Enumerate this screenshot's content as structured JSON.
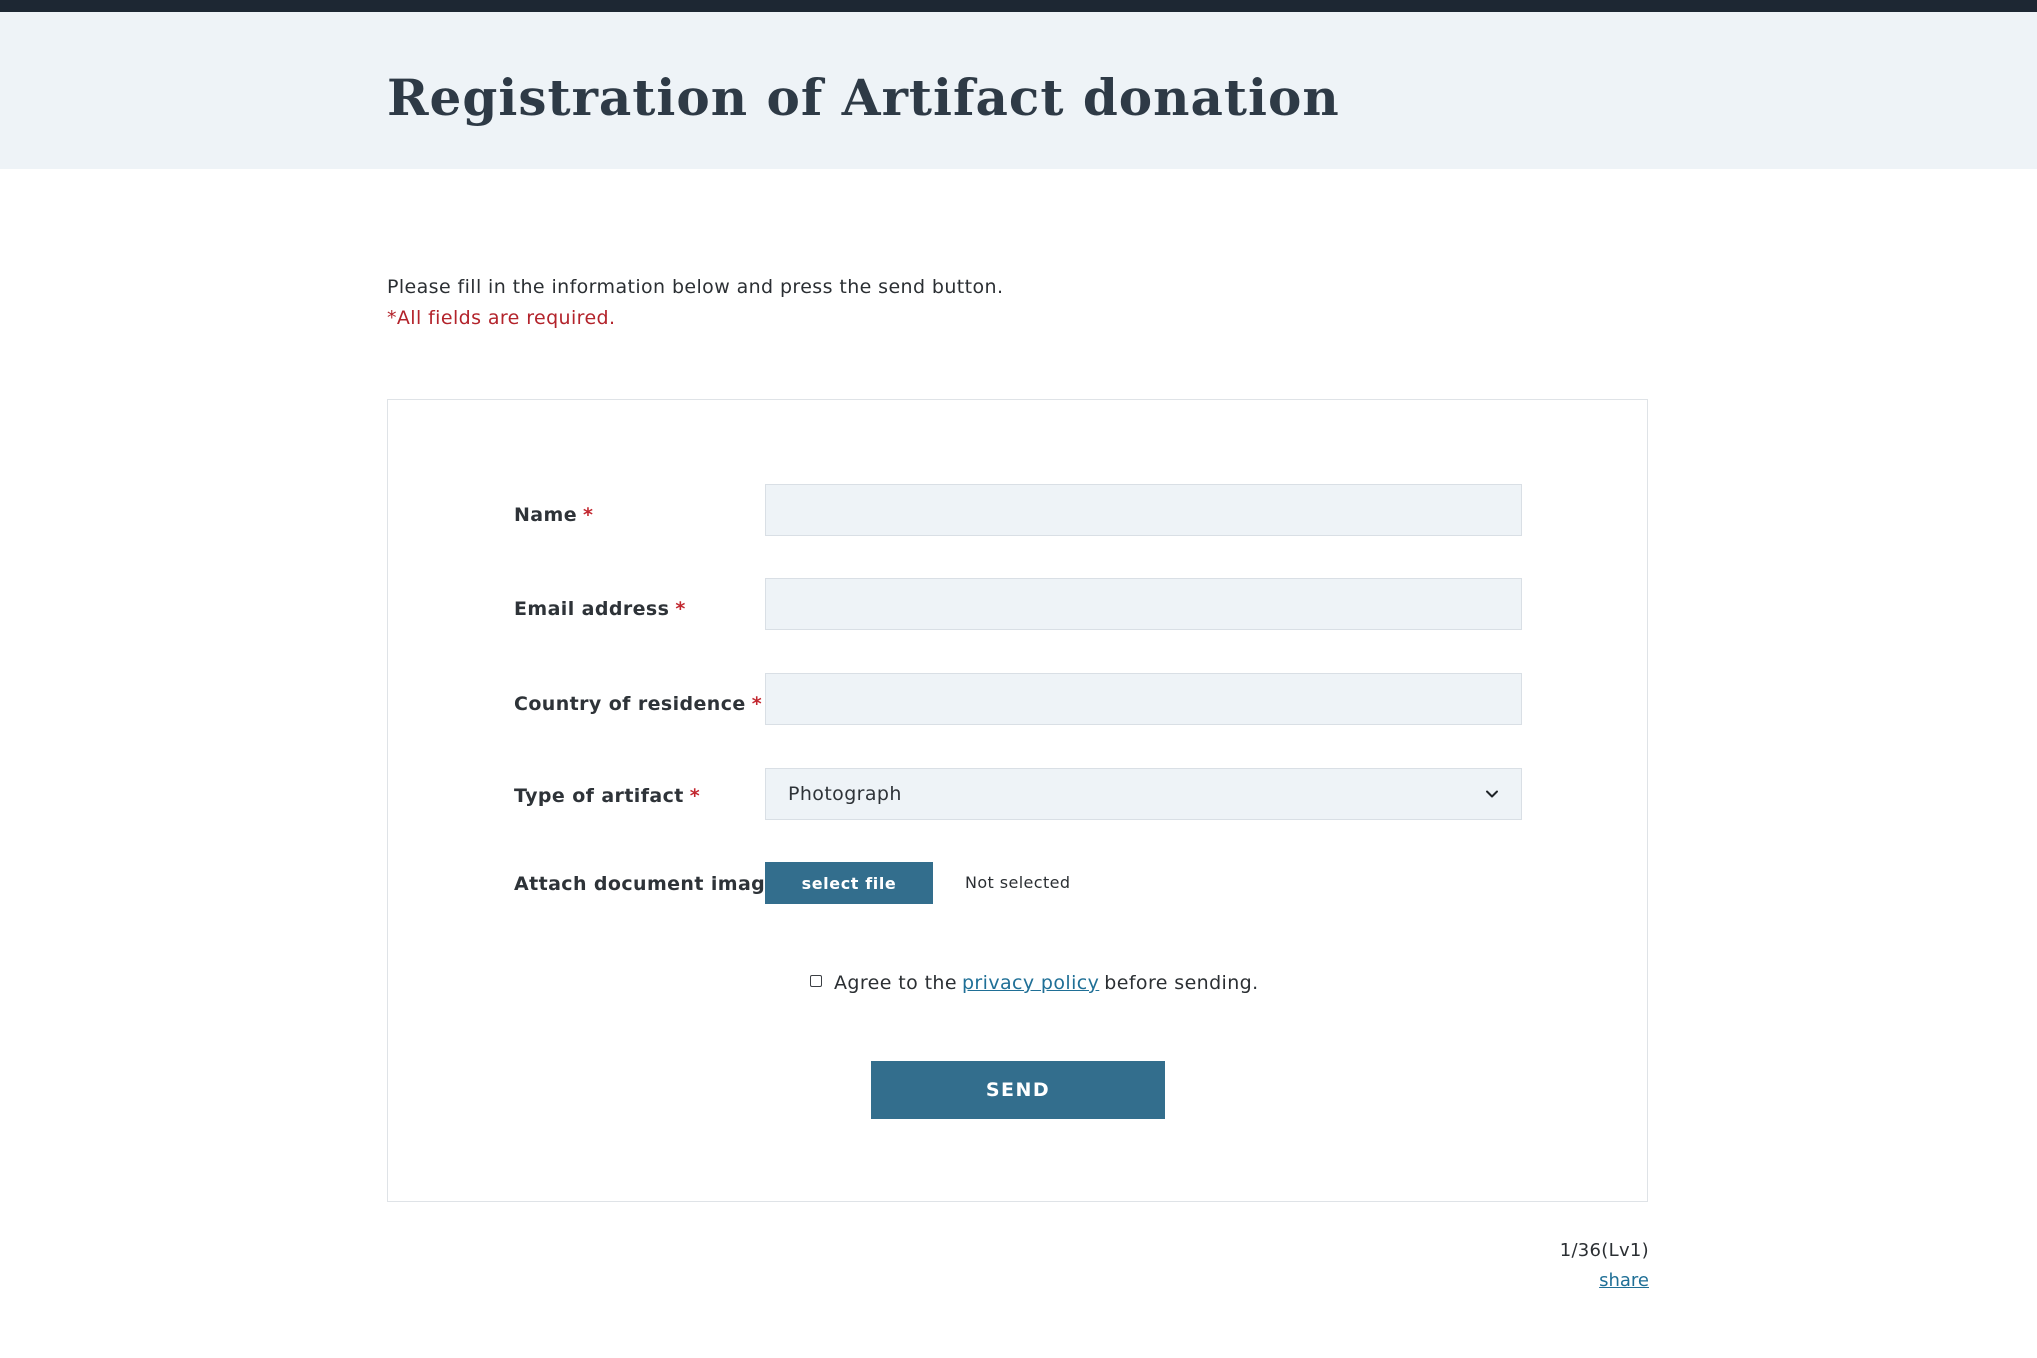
{
  "header": {
    "title": "Registration of Artifact donation"
  },
  "intro": {
    "text": "Please fill in the information below and press the send button.",
    "required_note": "*All fields are required."
  },
  "form": {
    "required_mark": "*",
    "fields": [
      {
        "label": "Name",
        "value": "",
        "type": "text"
      },
      {
        "label": "Email address",
        "value": "",
        "type": "text"
      },
      {
        "label": "Country of residence",
        "value": "",
        "type": "text"
      },
      {
        "label": "Type of artifact",
        "value": "Photograph",
        "type": "select"
      },
      {
        "label": "Attach document image",
        "type": "file"
      }
    ],
    "file_button_label": "select file",
    "file_status": "Not selected",
    "agree": {
      "checked": false,
      "before_link": "Agree to the",
      "link_text": "privacy policy",
      "after_link": "before sending."
    },
    "send_label": "SEND"
  },
  "footer": {
    "counter": "1/36(Lv1)",
    "share_label": "share"
  },
  "colors": {
    "accent": "#336e8d",
    "required": "#c2272f",
    "header_bg": "#eef3f7",
    "topbar": "#1d2733",
    "link": "#1f6f96"
  },
  "icons": {
    "select_arrow": "chevron-down-icon"
  }
}
